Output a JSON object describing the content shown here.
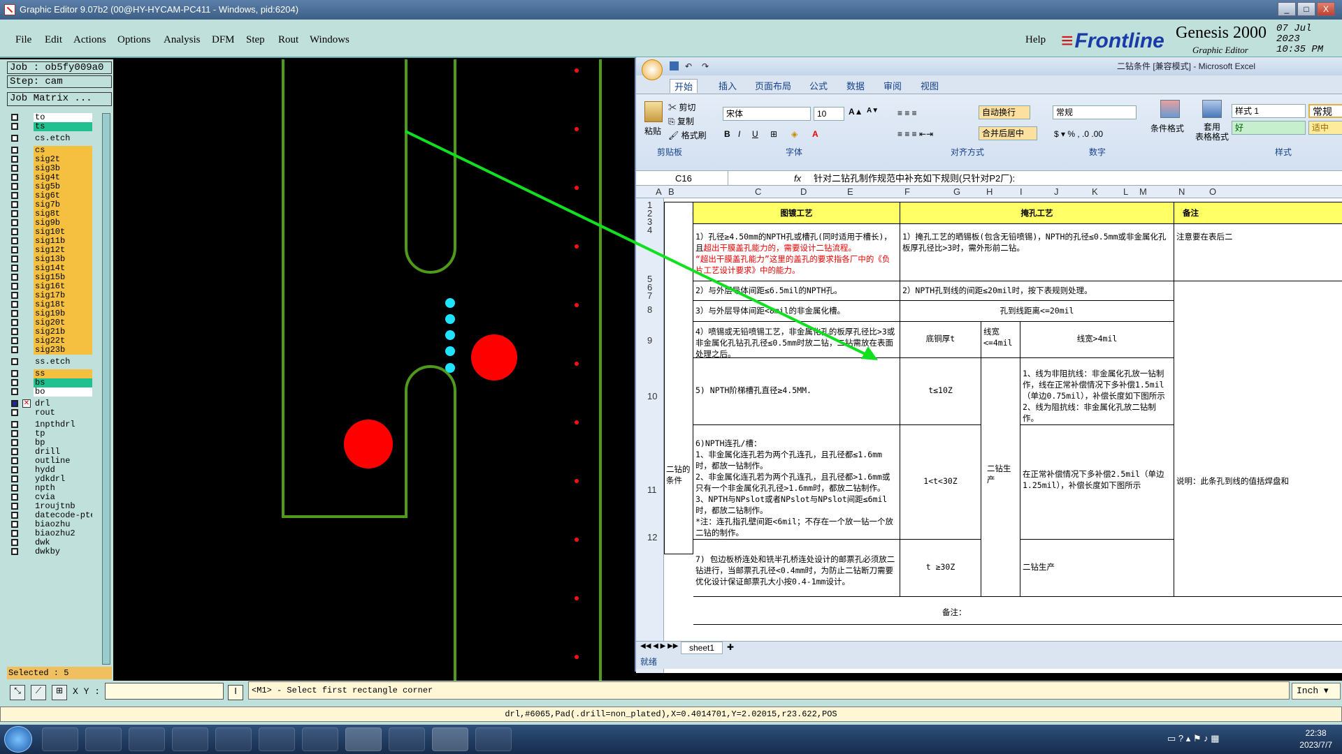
{
  "window": {
    "title": "Graphic Editor 9.07b2 (00@HY-HYCAM-PC411 - Windows, pid:6204)",
    "buttons": [
      "_",
      "□",
      "X"
    ]
  },
  "menu": {
    "items": [
      "File",
      "Edit",
      "Actions",
      "Options",
      "Analysis",
      "DFM",
      "Step",
      "Rout",
      "Windows"
    ],
    "help": "Help"
  },
  "logo": {
    "brand": "Frontline",
    "product": "Genesis 2000",
    "subtitle": "Graphic Editor",
    "date": "07 Jul 2023",
    "time": "10:35 PM"
  },
  "panel": {
    "job": "Job : ob5fy009a0",
    "step": "Step: cam",
    "job_matrix": "Job Matrix ...",
    "selected": "Selected : 5",
    "layers": [
      {
        "name": "to",
        "color": "#ffffff"
      },
      {
        "name": "ts",
        "color": "#20c090"
      },
      {
        "name": "cs.etch",
        "color": "#bfe0db"
      },
      {
        "name": "cs",
        "color": "#f5c040"
      },
      {
        "name": "sig2t",
        "color": "#f5c040"
      },
      {
        "name": "sig3b",
        "color": "#f5c040"
      },
      {
        "name": "sig4t",
        "color": "#f5c040"
      },
      {
        "name": "sig5b",
        "color": "#f5c040"
      },
      {
        "name": "sig6t",
        "color": "#f5c040"
      },
      {
        "name": "sig7b",
        "color": "#f5c040"
      },
      {
        "name": "sig8t",
        "color": "#f5c040"
      },
      {
        "name": "sig9b",
        "color": "#f5c040"
      },
      {
        "name": "sig10t",
        "color": "#f5c040"
      },
      {
        "name": "sig11b",
        "color": "#f5c040"
      },
      {
        "name": "sig12t",
        "color": "#f5c040"
      },
      {
        "name": "sig13b",
        "color": "#f5c040"
      },
      {
        "name": "sig14t",
        "color": "#f5c040"
      },
      {
        "name": "sig15b",
        "color": "#f5c040"
      },
      {
        "name": "sig16t",
        "color": "#f5c040"
      },
      {
        "name": "sig17b",
        "color": "#f5c040"
      },
      {
        "name": "sig18t",
        "color": "#f5c040"
      },
      {
        "name": "sig19b",
        "color": "#f5c040"
      },
      {
        "name": "sig20t",
        "color": "#f5c040"
      },
      {
        "name": "sig21b",
        "color": "#f5c040"
      },
      {
        "name": "sig22t",
        "color": "#f5c040"
      },
      {
        "name": "sig23b",
        "color": "#f5c040"
      },
      {
        "name": "ss.etch",
        "color": "#bfe0db"
      },
      {
        "name": "ss",
        "color": "#f5c040"
      },
      {
        "name": "bs",
        "color": "#20c090"
      },
      {
        "name": "bo",
        "color": "#ffffff"
      },
      {
        "name": "drl",
        "color": "#bfe0db",
        "active": true
      },
      {
        "name": "rout",
        "color": "#bfe0db"
      },
      {
        "name": "1npthdrl",
        "color": "#bfe0db"
      },
      {
        "name": "tp",
        "color": "#bfe0db"
      },
      {
        "name": "bp",
        "color": "#bfe0db"
      },
      {
        "name": "drill",
        "color": "#bfe0db"
      },
      {
        "name": "outline",
        "color": "#bfe0db"
      },
      {
        "name": "hydd",
        "color": "#bfe0db"
      },
      {
        "name": "ydkdrl",
        "color": "#bfe0db"
      },
      {
        "name": "npth",
        "color": "#bfe0db"
      },
      {
        "name": "cvia",
        "color": "#bfe0db"
      },
      {
        "name": "1roujtnb",
        "color": "#bfe0db"
      },
      {
        "name": "datecode-pte",
        "color": "#bfe0db"
      },
      {
        "name": "biaozhu",
        "color": "#bfe0db"
      },
      {
        "name": "biaozhu2",
        "color": "#bfe0db"
      },
      {
        "name": "dwk",
        "color": "#bfe0db"
      },
      {
        "name": "dwkby",
        "color": "#bfe0db"
      }
    ]
  },
  "bottom": {
    "xy_label": "X Y :",
    "prompt": "<M1> - Select first rectangle corner",
    "units": "Inch",
    "status": "drl,#6065,Pad(.drill=non_plated),X=0.4014701,Y=2.02015,r23.622,POS"
  },
  "excel": {
    "title": "二钻条件 [兼容模式] - Microsoft Excel",
    "tabs": [
      "开始",
      "插入",
      "页面布局",
      "公式",
      "数据",
      "审阅",
      "视图"
    ],
    "clipboard": {
      "paste": "粘贴",
      "cut": "剪切",
      "copy": "复制",
      "painter": "格式刷",
      "group": "剪贴板"
    },
    "font": {
      "name": "宋体",
      "size": "10",
      "group": "字体"
    },
    "align": {
      "wrap": "自动换行",
      "merge": "合并后居中",
      "group": "对齐方式"
    },
    "number": {
      "format": "常规",
      "group": "数字"
    },
    "styles": {
      "cond": "条件格式",
      "table": "套用\n表格格式",
      "style1": "样式 1",
      "normal": "常规",
      "good": "好",
      "neutral": "适中",
      "group": "样式"
    },
    "namebox": "C16",
    "formula": "针对二钻孔制作规范中补充如下规则(只针对P2厂):",
    "columns": [
      "A",
      "B",
      "C",
      "D",
      "E",
      "F",
      "G",
      "H",
      "I",
      "J",
      "K",
      "L",
      "M",
      "N",
      "O"
    ],
    "rows": [
      "1",
      "2",
      "3",
      "4",
      "5",
      "6",
      "7",
      "8",
      "9",
      "10",
      "11",
      "12"
    ],
    "cells": {
      "h1": "图镀工艺",
      "h2": "掩孔工艺",
      "h3": "备注",
      "b_label": "二钻的条件",
      "r5a": "1）孔径≥4.50mm的NPTH孔或槽孔(同时适用于槽长)，且",
      "r5b": "超出干膜盖孔能力的，需要设计二钻流程。",
      "r5c": "“超出干膜盖孔能力”这里的盖孔的要求指各厂中的《负片工艺设计要求》中的能力。",
      "r5j": "1）掩孔工艺的晒锡板(包含无铅喷锡)，NPTH的孔径≤0.5mm或非金属化孔板厚孔径比>3时，需外形前二钻。",
      "r5o": "注意要在表后二",
      "r6": "2）与外层导体间距≤6.5mil的NPTH孔。",
      "r6j": "2）NPTH孔到线的间距≤20mil时，按下表规则处理。",
      "r8": "3）与外层导体间距<8mil的非金属化槽。",
      "r8j": "孔到线距离<=20mil",
      "r9": "4）喷锡或无铅喷锡工艺，非金属化孔的板厚孔径比>3或非金属化孔钻孔孔径≤0.5mm时放二钻，二钻需放在表面处理之后。",
      "r9g": "底铜厚t",
      "r9i": "线宽<=4mil",
      "r9k": "线宽>4mil",
      "r10": "5) NPTH阶梯槽孔直径≥4.5MM.",
      "r10g": "t≤10Z",
      "r10k": "1、线为非阻抗线：非金属化孔放一钻制作，线在正常补偿情况下多补偿1.5mil（单边0.75mil），补偿长度如下图所示\n2、线为阻抗线：非金属化孔放二钻制作。",
      "r11": "6)NPTH连孔/槽：\n1、非金属化连孔若为两个孔连孔，且孔径都≤1.6mm时，都放一钻制作。\n2、非金属化连孔若为两个孔连孔，且孔径都>1.6mm或只有一个非金属化孔孔径>1.6mm时，都放二钻制作。\n3、NPTH与NPslot或者NPslot与NPslot间距≤6mil时，都放二钻制作。\n*注：连孔指孔壁间距<6mil；不存在一个放一钻一个放二钻的制作。",
      "r11g": "1<t<30Z",
      "r11i": "二钻生产",
      "r11k": "在正常补偿情况下多补偿2.5mil（单边1.25mil），补偿长度如下图所示",
      "r11o": "说明：此条孔到线的值括焊盘和",
      "r12": "7) 包边板桥连处和铣半孔桥连处设计的邮票孔必须放二钻进行，当邮票孔孔径<0.4mm时，为防止二钻断刀需要优化设计保证邮票孔大小按0.4-1mm设计。",
      "r12g": "t ≥30Z",
      "r12k": "二钻生产",
      "r13": "备注："
    },
    "sheet": "sheet1",
    "status": "就绪"
  },
  "taskbar": {
    "time": "22:38",
    "date": "2023/7/7"
  }
}
